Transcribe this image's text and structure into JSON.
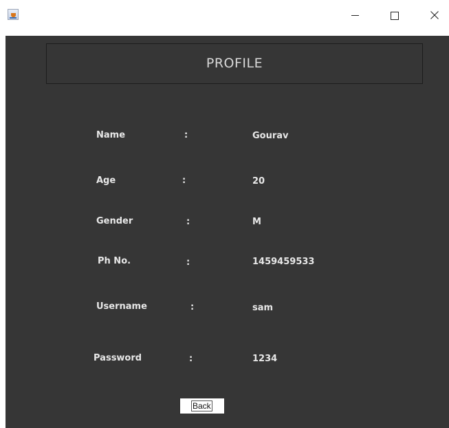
{
  "window": {
    "controls": {
      "minimize": "—",
      "maximize": "☐",
      "close": "×"
    }
  },
  "header": {
    "title": "PROFILE"
  },
  "profile": {
    "fields": [
      {
        "label": "Name",
        "separator": ":",
        "value": "Gourav"
      },
      {
        "label": "Age",
        "separator": ":",
        "value": "20"
      },
      {
        "label": "Gender",
        "separator": ":",
        "value": "M"
      },
      {
        "label": "Ph No.",
        "separator": ":",
        "value": "1459459533"
      },
      {
        "label": "Username",
        "separator": ":",
        "value": "sam"
      },
      {
        "label": "Password",
        "separator": ":",
        "value": "1234"
      }
    ]
  },
  "actions": {
    "back_label": "Back"
  },
  "colors": {
    "panel_background": "#363636",
    "text": "#e8e8e8",
    "title_text": "#d8d8d8"
  },
  "icons": {
    "app": "java-app-icon",
    "minimize": "minimize-icon",
    "maximize": "maximize-icon",
    "close": "close-icon"
  }
}
